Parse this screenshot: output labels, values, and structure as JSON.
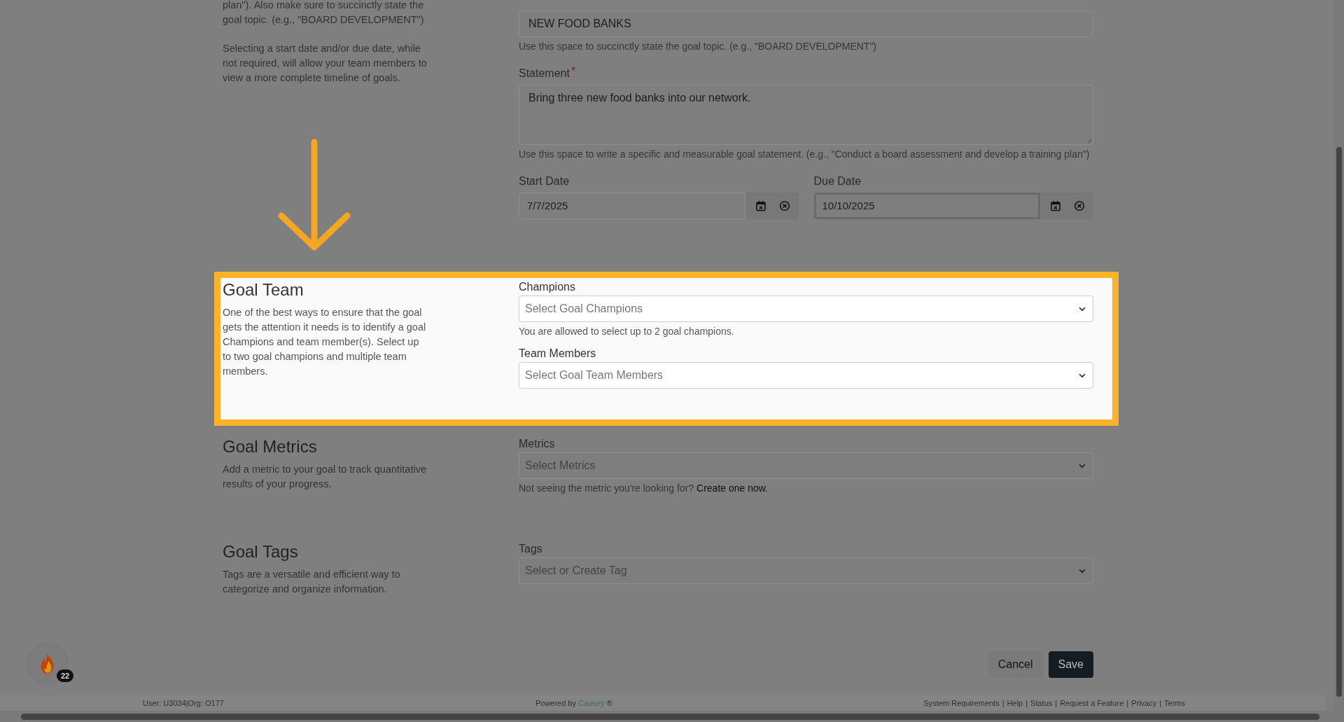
{
  "intro": {
    "paragraphs": [
      "plan\"). Also make sure to succinctly state the goal topic. (e.g., \"BOARD DEVELOPMENT\")",
      "Selecting a start date and/or due date, while not required, will allow your team members to view a more complete timeline of goals."
    ]
  },
  "topic": {
    "value": "NEW FOOD BANKS",
    "hint": "Use this space to succinctly state the goal topic. (e.g., \"BOARD DEVELOPMENT\")"
  },
  "statement": {
    "label": "Statement",
    "required_mark": "*",
    "value": "Bring three new food banks into our network.",
    "hint": "Use this space to write a specific and measurable goal statement. (e.g., \"Conduct a board assessment and develop a training plan\")"
  },
  "dates": [
    {
      "label": "Start Date",
      "value": "7/7/2025",
      "focused": false
    },
    {
      "label": "Due Date",
      "value": "10/10/2025",
      "focused": true
    }
  ],
  "sections": [
    {
      "title": "Goal Team",
      "highlighted": true,
      "description": "One of the best ways to ensure that the goal gets the attention it needs is to identify a goal Champions and team member(s). Select up to two goal champions and multiple team members.",
      "fields": [
        {
          "label": "Champions",
          "placeholder": "Select Goal Champions",
          "hint": "You are allowed to select up to 2 goal champions."
        },
        {
          "label": "Team Members",
          "placeholder": "Select Goal Team Members"
        }
      ]
    },
    {
      "title": "Goal Metrics",
      "highlighted": false,
      "description": "Add a metric to your goal to track quantitative results of your progress.",
      "fields": [
        {
          "label": "Metrics",
          "placeholder": "Select Metrics",
          "hint": "Not seeing the metric you're looking for?",
          "hint_link": "Create one now."
        }
      ]
    },
    {
      "title": "Goal Tags",
      "highlighted": false,
      "description": "Tags are a versatile and efficient way to categorize and organize information.",
      "fields": [
        {
          "label": "Tags",
          "placeholder": "Select or Create Tag"
        }
      ]
    }
  ],
  "actions": [
    {
      "label": "Cancel",
      "kind": "secondary"
    },
    {
      "label": "Save",
      "kind": "primary"
    }
  ],
  "badge": {
    "count": "22"
  },
  "footer": {
    "user": "User: U3034|Org: O177",
    "powered_prefix": "Powered by",
    "powered_link": "Causey",
    "powered_suffix": "®",
    "separator": "|",
    "links": [
      "System Requirements",
      "Help",
      "Status",
      "Request a Feature",
      "Privacy",
      "Terms"
    ]
  }
}
